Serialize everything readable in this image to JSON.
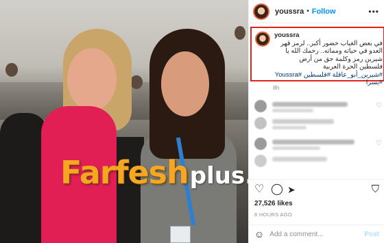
{
  "header": {
    "username": "youssra",
    "separator": "•",
    "follow_label": "Follow",
    "more_icon": "ellipsis-icon"
  },
  "caption": {
    "username": "youssra",
    "text": "في بعض الغياب حضور أكبر.. لرمز قهر العدو في حياته ومماته.. رحمك الله يا شيرين رمز وكلمة حق من أرض فلسطين الحرة العربية",
    "hashtags": "#شيرين_أبو_عاقلة #فلسطين #Youssra #يسرا",
    "time": "8h"
  },
  "watermark": {
    "brand": "Farfesh",
    "suffix": "plus.com"
  },
  "stats": {
    "likes": "27,526 likes",
    "time_ago": "8 HOURS AGO"
  },
  "comment_box": {
    "placeholder": "Add a comment...",
    "post_label": "Post"
  },
  "icons": {
    "like": "heart-icon",
    "comment": "comment-icon",
    "share": "share-icon",
    "save": "bookmark-icon",
    "emoji": "smile-icon"
  },
  "colors": {
    "follow": "#0095f6",
    "highlight_border": "#e2231a",
    "watermark": "#f5a623",
    "hashtag": "#00376b"
  }
}
